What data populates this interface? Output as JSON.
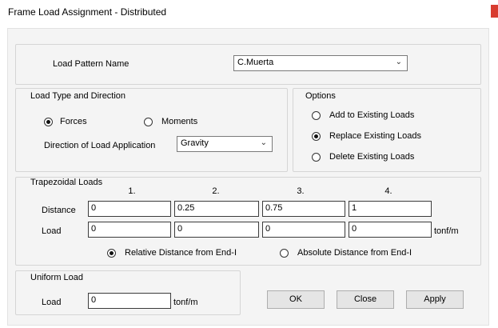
{
  "window": {
    "title": "Frame Load Assignment - Distributed"
  },
  "load_pattern": {
    "label": "Load Pattern Name",
    "value": "C.Muerta"
  },
  "load_type": {
    "title": "Load Type and Direction",
    "forces_label": "Forces",
    "moments_label": "Moments",
    "selected": "Forces",
    "direction_label": "Direction of Load Application",
    "direction_value": "Gravity"
  },
  "options": {
    "title": "Options",
    "items": [
      "Add to Existing Loads",
      "Replace Existing Loads",
      "Delete Existing Loads"
    ],
    "selected": "Replace Existing Loads"
  },
  "trapezoidal": {
    "title": "Trapezoidal Loads",
    "columns": [
      "1.",
      "2.",
      "3.",
      "4."
    ],
    "distance_label": "Distance",
    "distances": [
      "0",
      "0.25",
      "0.75",
      "1"
    ],
    "load_label": "Load",
    "loads": [
      "0",
      "0",
      "0",
      "0"
    ],
    "unit": "tonf/m",
    "relative_label": "Relative Distance from End-I",
    "absolute_label": "Absolute Distance from End-I",
    "selected": "Relative Distance from End-I"
  },
  "uniform": {
    "title": "Uniform Load",
    "load_label": "Load",
    "value": "0",
    "unit": "tonf/m"
  },
  "buttons": {
    "ok": "OK",
    "close": "Close",
    "apply": "Apply"
  }
}
